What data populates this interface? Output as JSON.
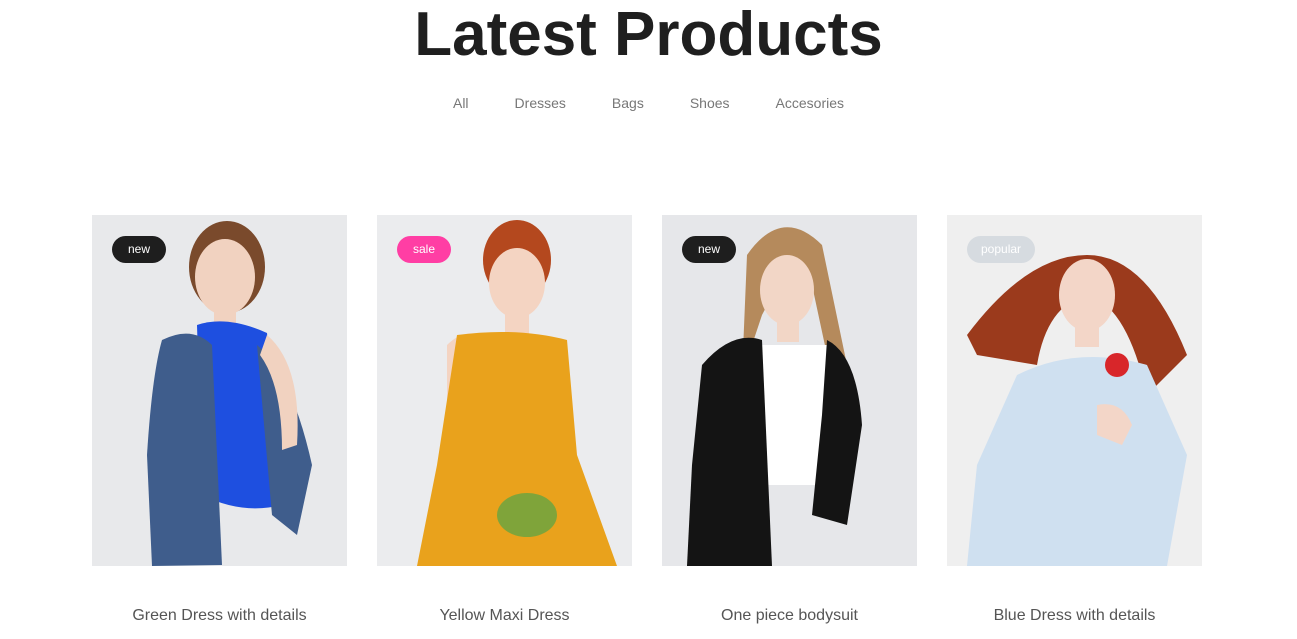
{
  "header": {
    "title": "Latest Products"
  },
  "filters": [
    {
      "label": "All"
    },
    {
      "label": "Dresses"
    },
    {
      "label": "Bags"
    },
    {
      "label": "Shoes"
    },
    {
      "label": "Accesories"
    }
  ],
  "products": [
    {
      "name": "Green Dress with details",
      "badge": "new",
      "badge_color": "#1e1e1e",
      "background": "#e8e9eb",
      "skin": "#f1d2c0",
      "hair": "#7a4a2c",
      "outfit": "#1e4fe0",
      "outfit_secondary": "#3f5d8c"
    },
    {
      "name": "Yellow Maxi Dress",
      "badge": "sale",
      "badge_color": "#ff3ea4",
      "background": "#ebecee",
      "skin": "#f4d4c2",
      "hair": "#b4481e",
      "outfit": "#e9a21c",
      "outfit_secondary": "#7fa43a"
    },
    {
      "name": "One piece bodysuit",
      "badge": "new",
      "badge_color": "#1e1e1e",
      "background": "#e6e7ea",
      "skin": "#f2d6c6",
      "hair": "#b58a5c",
      "outfit": "#141414",
      "outfit_secondary": "#ffffff"
    },
    {
      "name": "Blue Dress with details",
      "badge": "popular",
      "badge_color": "#d6dbe0",
      "background": "#efefef",
      "skin": "#f3d6c8",
      "hair": "#9b3a1c",
      "outfit": "#cfe0f0",
      "outfit_secondary": "#d8262a"
    }
  ]
}
